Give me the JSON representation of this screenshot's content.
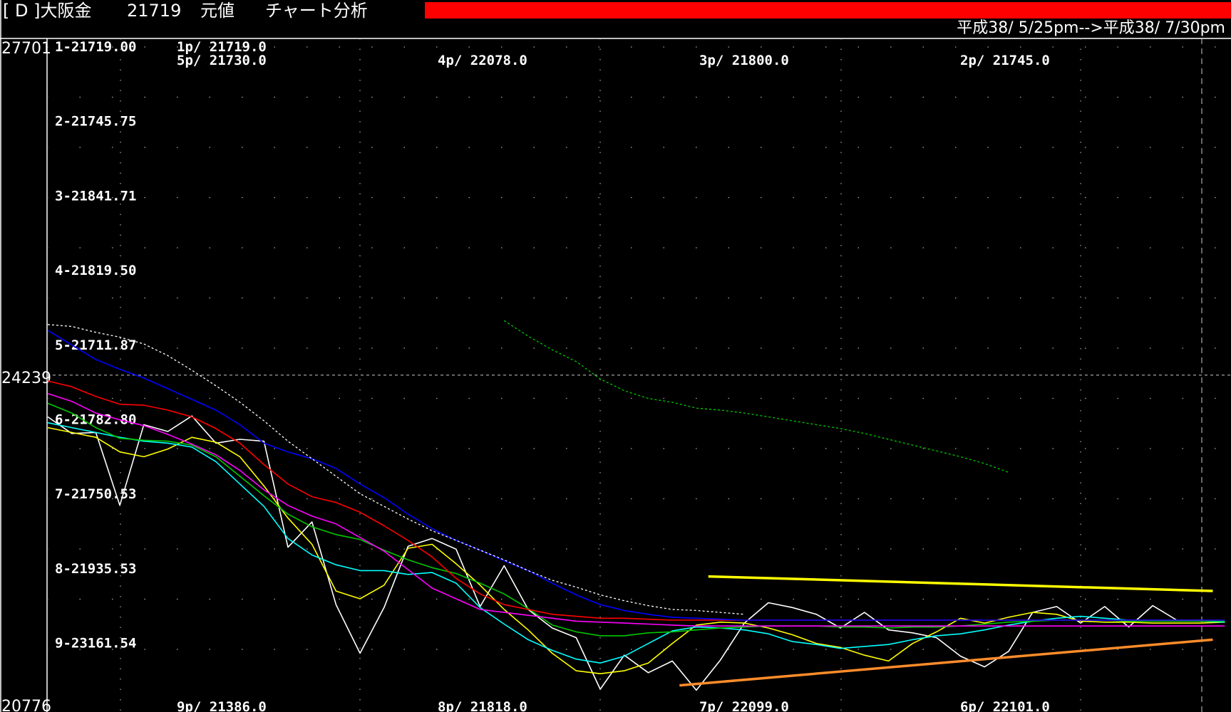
{
  "titlebar": {
    "code": "[ D ]大阪金",
    "price": "21719",
    "mode": "元値",
    "menu": "チャート分析",
    "alert_color": "#ff0000"
  },
  "header": {
    "date_range": "平成38/ 5/25pm-->平成38/ 7/30pm"
  },
  "axis": {
    "top_value": "27701",
    "mid_value": "24239",
    "bottom_value": "20776"
  },
  "chart_data": {
    "type": "line",
    "ylim": [
      20776,
      27701
    ],
    "reference_line": 24239,
    "grid": true,
    "row_labels": [
      "1-21719.00",
      "2-21745.75",
      "3-21841.71",
      "4-21819.50",
      "5-21711.87",
      "6-21782.80",
      "7-21750.53",
      "8-21935.53",
      "9-23161.54"
    ],
    "top_labels": [
      {
        "text": "1p/ 21719.0",
        "col": 0,
        "row": 0
      },
      {
        "text": "5p/ 21730.0",
        "col": 0,
        "row": 1
      },
      {
        "text": "4p/ 22078.0",
        "col": 1,
        "row": 1
      },
      {
        "text": "3p/ 21800.0",
        "col": 2,
        "row": 1
      },
      {
        "text": "2p/ 21745.0",
        "col": 3,
        "row": 1
      }
    ],
    "bottom_labels": [
      {
        "text": "9p/ 21386.0",
        "col": 0
      },
      {
        "text": "8p/ 21818.0",
        "col": 1
      },
      {
        "text": "7p/ 22099.0",
        "col": 2
      },
      {
        "text": "6p/ 22101.0",
        "col": 3
      }
    ],
    "x": [
      0,
      1,
      2,
      3,
      4,
      5,
      6,
      7,
      8,
      9,
      10,
      11,
      12,
      13,
      14,
      15,
      16,
      17,
      18,
      19,
      20,
      21,
      22,
      23,
      24,
      25,
      26,
      27,
      28,
      29,
      30,
      31,
      32,
      33,
      34,
      35,
      36,
      37,
      38,
      39,
      40,
      41,
      42,
      43,
      44,
      45,
      46,
      47,
      48,
      49
    ],
    "series": [
      {
        "color": "#ffffff",
        "style": "solid",
        "values": [
          23810,
          23640,
          23650,
          22900,
          23730,
          23660,
          23820,
          23540,
          23580,
          23560,
          22470,
          22730,
          21880,
          21380,
          21850,
          22480,
          22560,
          22450,
          21860,
          22280,
          21830,
          21640,
          21540,
          21010,
          21360,
          21180,
          21300,
          21000,
          21310,
          21690,
          21900,
          21850,
          21780,
          21640,
          21800,
          21620,
          21590,
          21540,
          21350,
          21240,
          21400,
          21800,
          21860,
          21690,
          21860,
          21650,
          21870,
          21720,
          21720,
          21700
        ]
      },
      {
        "color": "#ffff00",
        "style": "solid",
        "values": [
          23700,
          23650,
          23600,
          23450,
          23400,
          23480,
          23600,
          23550,
          23400,
          23100,
          22770,
          22500,
          22020,
          21940,
          22080,
          22460,
          22500,
          22300,
          22080,
          21830,
          21620,
          21380,
          21200,
          21170,
          21200,
          21280,
          21480,
          21670,
          21700,
          21690,
          21640,
          21570,
          21480,
          21440,
          21360,
          21300,
          21480,
          21600,
          21740,
          21690,
          21750,
          21800,
          21780,
          21710,
          21700,
          21700,
          21690,
          21690,
          21690,
          21700
        ]
      },
      {
        "color": "#00ffff",
        "style": "solid",
        "values": [
          23750,
          23700,
          23650,
          23600,
          23560,
          23540,
          23500,
          23350,
          23120,
          22890,
          22560,
          22390,
          22290,
          22230,
          22230,
          22190,
          22210,
          22100,
          21850,
          21680,
          21520,
          21410,
          21320,
          21280,
          21350,
          21480,
          21610,
          21650,
          21640,
          21620,
          21580,
          21500,
          21470,
          21430,
          21450,
          21470,
          21520,
          21560,
          21580,
          21620,
          21670,
          21710,
          21740,
          21760,
          21740,
          21720,
          21720,
          21720,
          21710,
          21700
        ]
      },
      {
        "color": "#00c800",
        "style": "solid",
        "values": [
          23950,
          23850,
          23700,
          23590,
          23570,
          23560,
          23520,
          23400,
          23200,
          23000,
          22810,
          22680,
          22600,
          22550,
          22440,
          22340,
          22260,
          22200,
          22100,
          21990,
          21840,
          21670,
          21600,
          21560,
          21560,
          21590,
          21600,
          21620,
          21640,
          21650,
          21660,
          21660,
          21660,
          21650,
          21650,
          21640,
          21650,
          21650,
          21660,
          21680,
          21700,
          21710,
          21720,
          21720,
          21720,
          21710,
          21710,
          21710,
          21710,
          21710
        ]
      },
      {
        "color": "#ff00ff",
        "style": "solid",
        "values": [
          24050,
          23970,
          23850,
          23780,
          23720,
          23630,
          23530,
          23420,
          23260,
          23060,
          22900,
          22790,
          22710,
          22570,
          22430,
          22240,
          22050,
          21940,
          21830,
          21800,
          21770,
          21740,
          21710,
          21700,
          21690,
          21680,
          21670,
          21660,
          21660,
          21660,
          21660,
          21660,
          21660,
          21660,
          21660,
          21660,
          21660,
          21660,
          21660,
          21660,
          21660,
          21660,
          21660,
          21660,
          21660,
          21660,
          21660,
          21660,
          21660,
          21660
        ]
      },
      {
        "color": "#ff0000",
        "style": "solid",
        "values": [
          24180,
          24120,
          24020,
          23940,
          23930,
          23880,
          23810,
          23690,
          23540,
          23320,
          23120,
          22990,
          22930,
          22830,
          22690,
          22540,
          22370,
          22150,
          21990,
          21880,
          21830,
          21780,
          21760,
          21740,
          21740,
          21730,
          21720,
          21720,
          21720,
          21720,
          21720,
          21720,
          21720,
          21720,
          21720,
          21720,
          21720,
          21720,
          21720,
          21720,
          21720,
          21720,
          21720,
          21720,
          21720,
          21720,
          21720,
          21720,
          21720,
          21720
        ]
      },
      {
        "color": "#0000ff",
        "style": "solid",
        "values": [
          24700,
          24550,
          24400,
          24300,
          24210,
          24100,
          23990,
          23880,
          23730,
          23540,
          23450,
          23380,
          23280,
          23120,
          22980,
          22810,
          22660,
          22540,
          22440,
          22330,
          22230,
          22100,
          21980,
          21880,
          21820,
          21780,
          21750,
          21740,
          21730,
          21720,
          21720,
          21720,
          21720,
          21720,
          21720,
          21720,
          21720,
          21720,
          21720,
          21720,
          21720,
          21720,
          21720,
          21720,
          21720,
          21720,
          21720,
          21720,
          21720,
          21720
        ]
      },
      {
        "color": "#ffffff",
        "style": "dotted",
        "values": [
          24760,
          24740,
          24680,
          24630,
          24560,
          24440,
          24290,
          24130,
          23960,
          23770,
          23560,
          23380,
          23200,
          23020,
          22890,
          22760,
          22640,
          22540,
          22440,
          22340,
          22230,
          22130,
          22060,
          21980,
          21920,
          21870,
          21830,
          21820,
          21800,
          21780
        ]
      },
      {
        "color": "#00c800",
        "style": "dotted",
        "x0": 19,
        "values": [
          24800,
          24640,
          24500,
          24380,
          24200,
          24080,
          24000,
          23960,
          23900,
          23880,
          23850,
          23810,
          23770,
          23730,
          23690,
          23640,
          23580,
          23520,
          23460,
          23400,
          23330,
          23240
        ]
      }
    ],
    "trendlines": [
      {
        "color": "#ffff00",
        "x": [
          27.5,
          48.5
        ],
        "y": [
          22170,
          22020
        ]
      },
      {
        "color": "#ff8c2a",
        "x": [
          26.3,
          48.5
        ],
        "y": [
          21050,
          21520
        ]
      }
    ]
  }
}
